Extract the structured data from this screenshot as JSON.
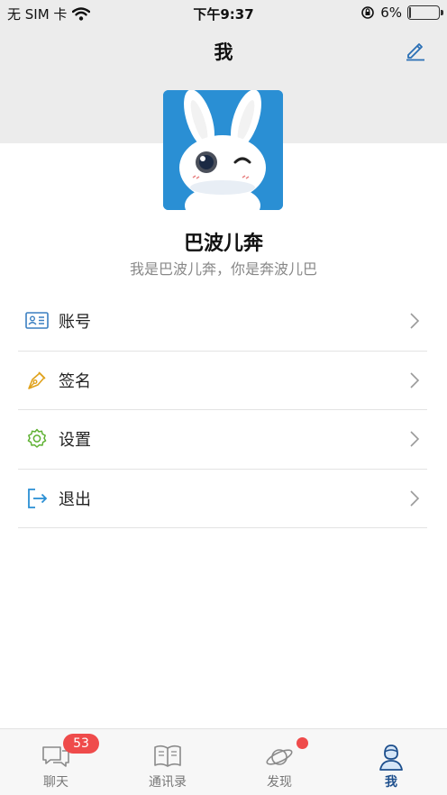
{
  "status_bar": {
    "carrier": "无 SIM 卡",
    "time": "下午9:37",
    "battery_percent": "6%",
    "battery_level": 0.06
  },
  "header": {
    "title": "我",
    "edit_icon": "edit-pen-icon"
  },
  "profile": {
    "name": "巴波儿奔",
    "signature": "我是巴波儿奔，你是奔波儿巴",
    "avatar_bg": "#2a8fd4"
  },
  "menu": [
    {
      "label": "账号",
      "icon": "id-card-icon",
      "color": "#3a7fc1"
    },
    {
      "label": "签名",
      "icon": "pen-nib-icon",
      "color": "#e0a21c"
    },
    {
      "label": "设置",
      "icon": "gear-icon",
      "color": "#5fb233"
    },
    {
      "label": "退出",
      "icon": "logout-icon",
      "color": "#2a8fd4"
    }
  ],
  "tabs": [
    {
      "label": "聊天",
      "icon": "chat-icon",
      "badge": "53"
    },
    {
      "label": "通讯录",
      "icon": "contacts-book-icon"
    },
    {
      "label": "发现",
      "icon": "planet-icon"
    },
    {
      "label": "我",
      "icon": "person-icon",
      "active": true
    }
  ],
  "colors": {
    "accent": "#1c4e8c",
    "badge": "#ef4b4b",
    "header_bg": "#ececec"
  }
}
